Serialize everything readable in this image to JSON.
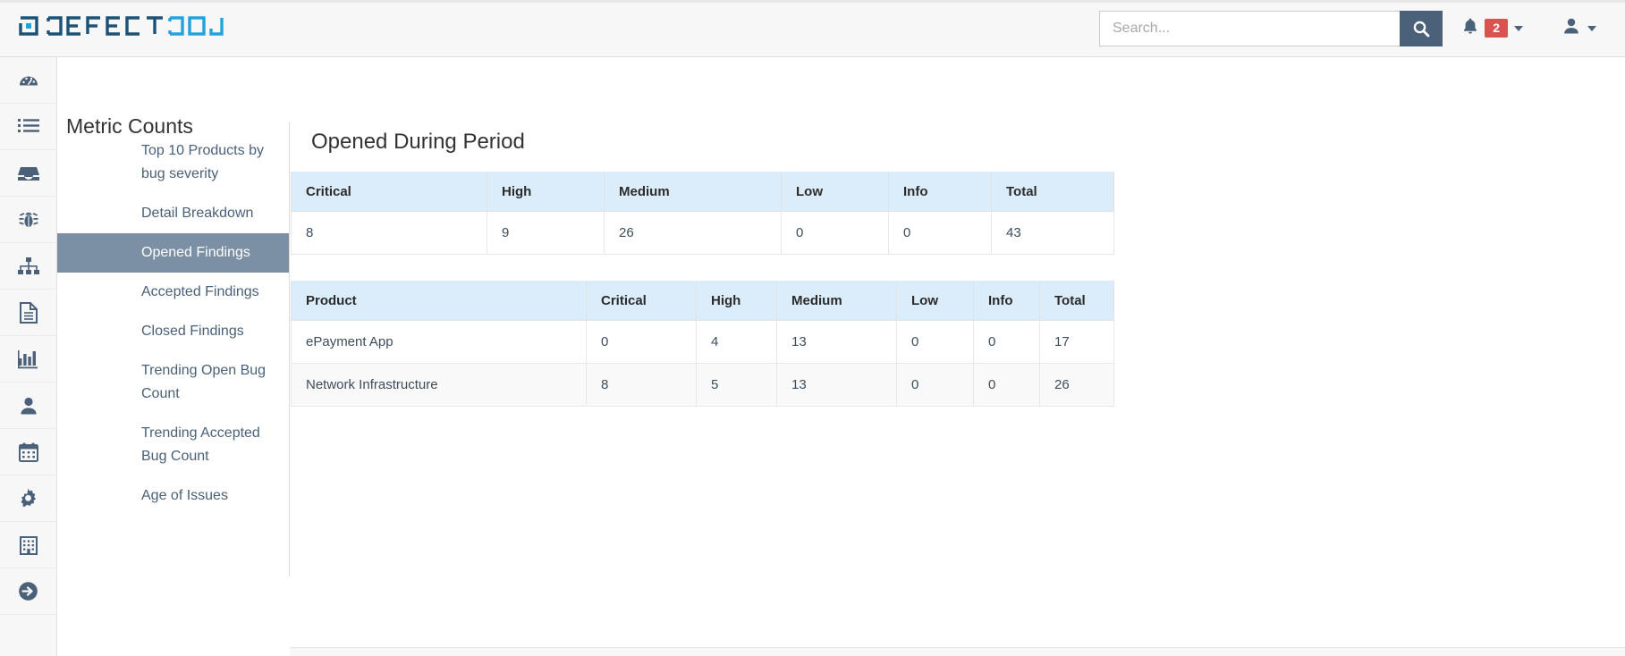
{
  "header": {
    "brand_primary": "DEFECT",
    "brand_secondary": "DOJO",
    "brand_color_dark": "#1b5276",
    "brand_color_light": "#21a3dd",
    "search": {
      "placeholder": "Search...",
      "value": "",
      "button_icon": "search-icon"
    },
    "notifications": {
      "icon": "bell-icon",
      "count": "2",
      "caret_icon": "chevron-down-icon"
    },
    "user_menu": {
      "icon": "user-icon",
      "caret_icon": "chevron-down-icon"
    }
  },
  "rail": {
    "items": [
      {
        "icon": "dashboard-icon",
        "name": "dashboard"
      },
      {
        "icon": "list-icon",
        "name": "findings"
      },
      {
        "icon": "inbox-icon",
        "name": "engagements"
      },
      {
        "icon": "bug-icon",
        "name": "products"
      },
      {
        "icon": "sitemap-icon",
        "name": "product-types"
      },
      {
        "icon": "document-icon",
        "name": "reports"
      },
      {
        "icon": "bar-chart-icon",
        "name": "metrics"
      },
      {
        "icon": "user-icon",
        "name": "users"
      },
      {
        "icon": "calendar-icon",
        "name": "calendar"
      },
      {
        "icon": "gear-icon",
        "name": "configuration"
      },
      {
        "icon": "building-icon",
        "name": "organization"
      },
      {
        "icon": "arrow-circle-right-icon",
        "name": "logout"
      }
    ]
  },
  "subnav": {
    "title": "Metric Counts",
    "items": [
      {
        "label": "Top 10 Products by bug severity",
        "active": false
      },
      {
        "label": "Detail Breakdown",
        "active": false
      },
      {
        "label": "Opened Findings",
        "active": true
      },
      {
        "label": "Accepted Findings",
        "active": false
      },
      {
        "label": "Closed Findings",
        "active": false
      },
      {
        "label": "Trending Open Bug Count",
        "active": false
      },
      {
        "label": "Trending Accepted Bug Count",
        "active": false
      },
      {
        "label": "Age of Issues",
        "active": false
      }
    ],
    "active_bg": "#7b8fa5"
  },
  "main": {
    "page_title": "Opened During Period",
    "severity_table": {
      "columns": [
        "Critical",
        "High",
        "Medium",
        "Low",
        "Info",
        "Total"
      ],
      "rows": [
        [
          "8",
          "9",
          "26",
          "0",
          "0",
          "43"
        ]
      ]
    },
    "product_table": {
      "columns": [
        "Product",
        "Critical",
        "High",
        "Medium",
        "Low",
        "Info",
        "Total"
      ],
      "rows": [
        [
          "ePayment App",
          "0",
          "4",
          "13",
          "0",
          "0",
          "17"
        ],
        [
          "Network Infrastructure",
          "8",
          "5",
          "13",
          "0",
          "0",
          "26"
        ]
      ]
    },
    "table_header_bg": "#dbedfa"
  }
}
